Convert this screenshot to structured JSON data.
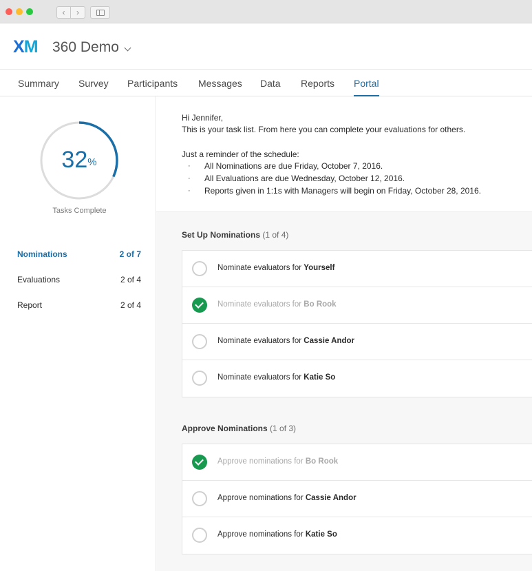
{
  "app": {
    "logo": {
      "x": "X",
      "m": "M"
    },
    "project_title": "360 Demo"
  },
  "tabs": [
    {
      "label": "Summary"
    },
    {
      "label": "Survey"
    },
    {
      "label": "Participants"
    },
    {
      "label": "Messages"
    },
    {
      "label": "Data"
    },
    {
      "label": "Reports"
    },
    {
      "label": "Portal",
      "active": true
    }
  ],
  "sidebar": {
    "progress_value": "32",
    "progress_unit": "%",
    "progress_fraction": 0.32,
    "progress_label": "Tasks Complete",
    "items": [
      {
        "label": "Nominations",
        "count": "2 of 7",
        "active": true
      },
      {
        "label": "Evaluations",
        "count": "2 of 4"
      },
      {
        "label": "Report",
        "count": "2 of 4"
      }
    ]
  },
  "intro": {
    "greeting": "Hi Jennifer,",
    "body": "This is your task list. From here you can complete your evaluations for others.",
    "reminder": "Just a reminder of the schedule:",
    "bullet_glyph": "·",
    "bullets": [
      "All Nominations are due Friday, October 7, 2016.",
      "All Evaluations are due Wednesday, October 12, 2016.",
      "Reports given in 1:1s with Managers will begin on Friday, October 28, 2016."
    ]
  },
  "sections": {
    "setup": {
      "title": "Set Up Nominations",
      "subtitle": "(1 of 4)",
      "tasks": [
        {
          "prefix": "Nominate evaluators for ",
          "name": "Yourself",
          "done": false
        },
        {
          "prefix": "Nominate evaluators for ",
          "name": "Bo Rook",
          "done": true
        },
        {
          "prefix": "Nominate evaluators for ",
          "name": "Cassie Andor",
          "done": false
        },
        {
          "prefix": "Nominate evaluators for ",
          "name": "Katie So",
          "done": false
        }
      ]
    },
    "approve": {
      "title": "Approve Nominations",
      "subtitle": "(1 of 3)",
      "tasks": [
        {
          "prefix": "Approve nominations for ",
          "name": "Bo Rook",
          "done": true
        },
        {
          "prefix": "Approve nominations for ",
          "name": "Cassie Andor",
          "done": false
        },
        {
          "prefix": "Approve nominations for ",
          "name": "Katie So",
          "done": false
        }
      ]
    }
  },
  "colors": {
    "accent": "#1a6fa8",
    "done_green": "#17994f"
  },
  "icons": {
    "back": "‹",
    "forward": "›"
  }
}
